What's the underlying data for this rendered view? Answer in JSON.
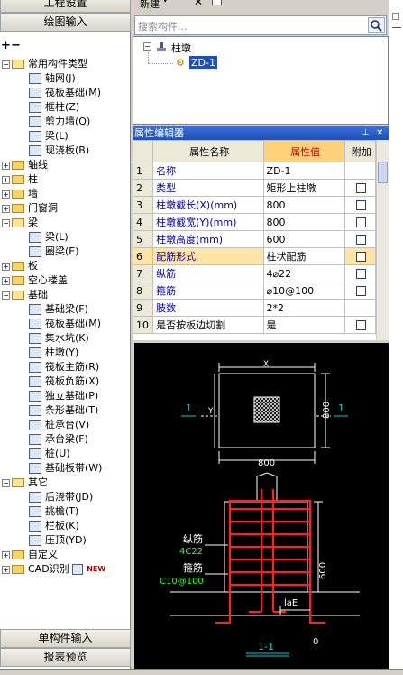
{
  "left_panel": {
    "strip_top": "工程设置",
    "strip_draw": "绘图输入",
    "toolbar_icons": [
      "add-icon",
      "remove-icon"
    ],
    "tree": [
      {
        "label": "常用构件类型",
        "level": 0,
        "type": "folder-open"
      },
      {
        "label": "轴网(J)",
        "level": 1,
        "type": "item"
      },
      {
        "label": "筏板基础(M)",
        "level": 1,
        "type": "item"
      },
      {
        "label": "框柱(Z)",
        "level": 1,
        "type": "item"
      },
      {
        "label": "剪力墙(Q)",
        "level": 1,
        "type": "item"
      },
      {
        "label": "梁(L)",
        "level": 1,
        "type": "item"
      },
      {
        "label": "现浇板(B)",
        "level": 1,
        "type": "item"
      },
      {
        "label": "轴线",
        "level": 0,
        "type": "folder"
      },
      {
        "label": "柱",
        "level": 0,
        "type": "folder"
      },
      {
        "label": "墙",
        "level": 0,
        "type": "folder"
      },
      {
        "label": "门窗洞",
        "level": 0,
        "type": "folder"
      },
      {
        "label": "梁",
        "level": 0,
        "type": "folder-open"
      },
      {
        "label": "梁(L)",
        "level": 1,
        "type": "item"
      },
      {
        "label": "圈梁(E)",
        "level": 1,
        "type": "item"
      },
      {
        "label": "板",
        "level": 0,
        "type": "folder"
      },
      {
        "label": "空心楼盖",
        "level": 0,
        "type": "folder"
      },
      {
        "label": "基础",
        "level": 0,
        "type": "folder-open"
      },
      {
        "label": "基础梁(F)",
        "level": 1,
        "type": "item"
      },
      {
        "label": "筏板基础(M)",
        "level": 1,
        "type": "item"
      },
      {
        "label": "集水坑(K)",
        "level": 1,
        "type": "item"
      },
      {
        "label": "柱墩(Y)",
        "level": 1,
        "type": "item"
      },
      {
        "label": "筏板主筋(R)",
        "level": 1,
        "type": "item"
      },
      {
        "label": "筏板负筋(X)",
        "level": 1,
        "type": "item"
      },
      {
        "label": "独立基础(P)",
        "level": 1,
        "type": "item"
      },
      {
        "label": "条形基础(T)",
        "level": 1,
        "type": "item"
      },
      {
        "label": "桩承台(V)",
        "level": 1,
        "type": "item"
      },
      {
        "label": "承台梁(F)",
        "level": 1,
        "type": "item"
      },
      {
        "label": "桩(U)",
        "level": 1,
        "type": "item"
      },
      {
        "label": "基础板带(W)",
        "level": 1,
        "type": "item"
      },
      {
        "label": "其它",
        "level": 0,
        "type": "folder-open"
      },
      {
        "label": "后浇带(JD)",
        "level": 1,
        "type": "item"
      },
      {
        "label": "挑檐(T)",
        "level": 1,
        "type": "item"
      },
      {
        "label": "栏板(K)",
        "level": 1,
        "type": "item"
      },
      {
        "label": "压顶(YD)",
        "level": 1,
        "type": "item"
      },
      {
        "label": "自定义",
        "level": 0,
        "type": "folder"
      },
      {
        "label": "CAD识别",
        "level": 0,
        "type": "folder",
        "badge": "NEW"
      }
    ],
    "strip_single": "单构件输入",
    "strip_report": "报表预览"
  },
  "top": {
    "new_label": "新建",
    "search_placeholder": "搜索构件..."
  },
  "component_tree": {
    "root": "柱墩",
    "child": "ZD-1"
  },
  "property_editor": {
    "title": "属性编辑器",
    "columns": [
      "属性名称",
      "属性值",
      "附加"
    ],
    "rows": [
      {
        "num": "1",
        "name": "名称",
        "value": "ZD-1",
        "check": false,
        "plain": false
      },
      {
        "num": "2",
        "name": "类型",
        "value": "矩形上柱墩",
        "check": true,
        "plain": false
      },
      {
        "num": "3",
        "name": "柱墩截长(X)(mm)",
        "value": "800",
        "check": true,
        "plain": false
      },
      {
        "num": "4",
        "name": "柱墩截宽(Y)(mm)",
        "value": "800",
        "check": true,
        "plain": false
      },
      {
        "num": "5",
        "name": "柱墩高度(mm)",
        "value": "600",
        "check": true,
        "plain": false
      },
      {
        "num": "6",
        "name": "配筋形式",
        "value": "柱状配筋",
        "check": true,
        "plain": false
      },
      {
        "num": "7",
        "name": "纵筋",
        "value": "4⌀22",
        "check": true,
        "plain": false
      },
      {
        "num": "8",
        "name": "箍筋",
        "value": "⌀10@100",
        "check": true,
        "plain": false
      },
      {
        "num": "9",
        "name": "肢数",
        "value": "2*2",
        "check": false,
        "plain": false
      },
      {
        "num": "10",
        "name": "是否按板边切割",
        "value": "是",
        "check": true,
        "plain": true
      }
    ]
  },
  "drawing": {
    "dim_x": "X",
    "dim_y": "Y",
    "dim_800_bottom": "800",
    "dim_800_right": "800",
    "section_mark": "1",
    "section_label": "1-1",
    "label_long": "纵筋",
    "label_long_val": "4C22",
    "label_stirrup": "箍筋",
    "label_stirrup_val": "C10@100",
    "dim_600": "600",
    "dim_lae": "laE",
    "dim_zero": "0"
  }
}
